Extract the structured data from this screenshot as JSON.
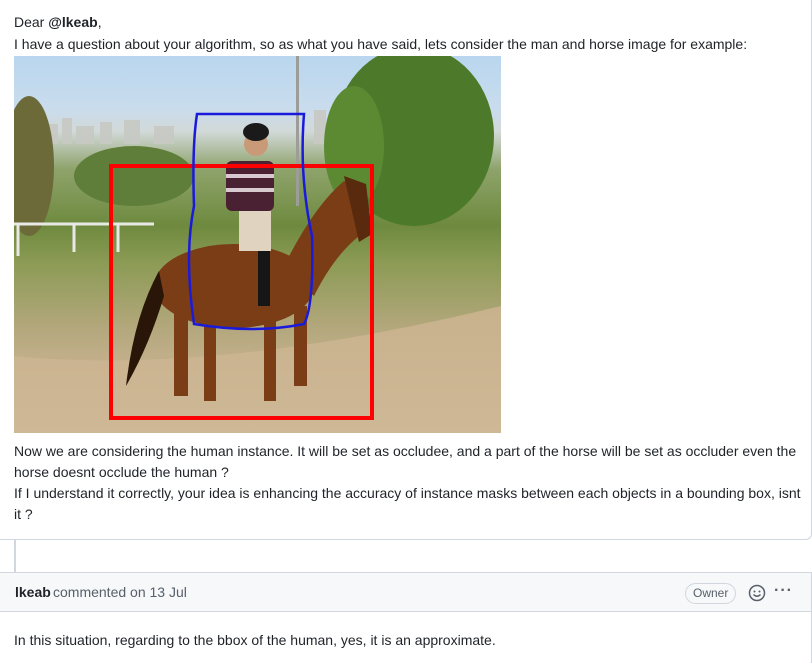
{
  "comment1": {
    "greeting_prefix": "Dear ",
    "mention": "@lkeab",
    "greeting_suffix": ",",
    "line1": "I have a question about your algorithm, so as what you have said, lets consider the man and horse image for example:",
    "para1_line1": "Now we are considering the human instance. It will be set as occludee, and a part of the horse will be set as occluder even the",
    "para1_line2": "horse doesnt occlude the human ?",
    "para2_line1": "If I understand it correctly, your idea is enhancing the accuracy of instance masks between each objects in a bounding box, isnt",
    "para2_line2": "it ?"
  },
  "image": {
    "description_icon": "photo-man-riding-horse",
    "box_colors": {
      "horse_bbox": "#ff0000",
      "human_mask": "#1a1adb"
    }
  },
  "comment2": {
    "author": "lkeab",
    "commented": "commented on 13 Jul",
    "badge": "Owner",
    "emoji_icon": "smiley-icon",
    "more_icon": "kebab-icon",
    "more_label": "···",
    "body": "In this situation, regarding to the bbox of the human, yes, it is an approximate."
  }
}
